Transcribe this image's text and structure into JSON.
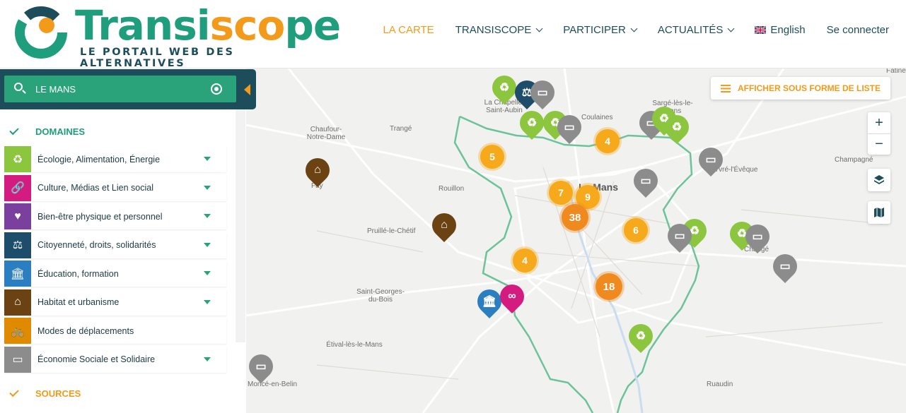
{
  "header": {
    "logo_title": "Transiscope",
    "logo_subtitle": "LE PORTAIL WEB DES ALTERNATIVES",
    "nav": [
      {
        "label": "LA CARTE",
        "active": true,
        "dropdown": false
      },
      {
        "label": "TRANSISCOPE",
        "active": false,
        "dropdown": true
      },
      {
        "label": "PARTICIPER",
        "active": false,
        "dropdown": true
      },
      {
        "label": "ACTUALITÉS",
        "active": false,
        "dropdown": true
      }
    ],
    "language": "English",
    "login": "Se connecter"
  },
  "search": {
    "value": "LE MANS"
  },
  "sidebar": {
    "domains_title": "DOMAINES",
    "sources_title": "SOURCES",
    "domains": [
      {
        "label": "Écologie, Alimentation, Énergie",
        "color": "#8cc63f",
        "icon": "recycle-icon",
        "glyph": "♻"
      },
      {
        "label": "Culture, Médias et Lien social",
        "color": "#d41b7f",
        "icon": "link-icon",
        "glyph": "🔗"
      },
      {
        "label": "Bien-être physique et personnel",
        "color": "#7b3f9e",
        "icon": "heart-icon",
        "glyph": "♥"
      },
      {
        "label": "Citoyenneté, droits, solidarités",
        "color": "#1d4d6a",
        "icon": "scales-icon",
        "glyph": "⚖"
      },
      {
        "label": "Éducation, formation",
        "color": "#2b7fc0",
        "icon": "institution-icon",
        "glyph": "🏛"
      },
      {
        "label": "Habitat et urbanisme",
        "color": "#6b4211",
        "icon": "house-icon",
        "glyph": "⌂"
      },
      {
        "label": "Modes de déplacements",
        "color": "#e08a00",
        "icon": "bicycle-icon",
        "glyph": "🚲"
      },
      {
        "label": "Économie Sociale et Solidaire",
        "color": "#8c8c8c",
        "icon": "banknote-icon",
        "glyph": "▭"
      }
    ]
  },
  "map": {
    "list_button": "AFFICHER SOUS FORME DE LISTE",
    "zoom_in": "+",
    "zoom_out": "−",
    "places": [
      "Fatines",
      "La Chapelle-Saint-Aubin",
      "Coulaines",
      "Sargé-lès-le-Mans",
      "Chaufour-Notre-Dame",
      "Trangé",
      "Champagné",
      "Yvré-l'Évêque",
      "Fay",
      "Rouillon",
      "Le Mans",
      "Pruillé-le-Chétif",
      "Changé",
      "Saint-Georges-du-Bois",
      "Étival-lès-le-Mans",
      "Ruaudin",
      "Moncé-en-Belin"
    ],
    "clusters": [
      "5",
      "4",
      "7",
      "9",
      "38",
      "6",
      "4",
      "18"
    ]
  }
}
